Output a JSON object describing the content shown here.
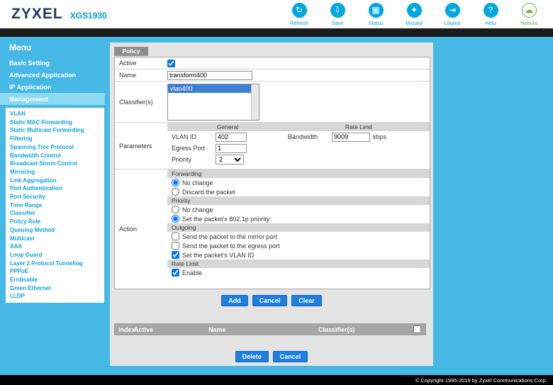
{
  "header": {
    "logo": "ZYXEL",
    "model": "XGS1930",
    "toolbar": [
      {
        "label": "Refresh",
        "glyph": "↻"
      },
      {
        "label": "Save",
        "glyph": "⇩"
      },
      {
        "label": "Status",
        "glyph": "▦"
      },
      {
        "label": "Wizard",
        "glyph": "✦"
      },
      {
        "label": "Logout",
        "glyph": "⇥"
      },
      {
        "label": "Help",
        "glyph": "?"
      },
      {
        "label": "Nebula",
        "glyph": "☁"
      }
    ]
  },
  "sidebar": {
    "title": "Menu",
    "sections": [
      {
        "label": "Basic Setting",
        "active": false
      },
      {
        "label": "Advanced Application",
        "active": false
      },
      {
        "label": "IP Application",
        "active": false
      },
      {
        "label": "Management",
        "active": true
      }
    ],
    "links": [
      "VLAN",
      "Static MAC Forwarding",
      "Static Multicast Forwarding",
      "Filtering",
      "Spanning Tree Protocol",
      "Bandwidth Control",
      "Broadcast Storm Control",
      "Mirroring",
      "Link Aggregation",
      "Port Authentication",
      "Port Security",
      "Time Range",
      "Classifier",
      "Policy Rule",
      "Queuing Method",
      "Multicast",
      "AAA",
      "Loop Guard",
      "Layer 2 Protocol Tunneling",
      "PPPoE",
      "Errdisable",
      "Green Ethernet",
      "LLDP"
    ]
  },
  "content": {
    "tab_label": "Policy",
    "form": {
      "active_label": "Active",
      "active_checked": true,
      "name_label": "Name",
      "name_value": "transform400",
      "classifiers_label": "Classifier(s)",
      "classifier_selected": "vlan400",
      "parameters_label": "Parameters",
      "general_header": "General",
      "rate_limit_header": "Rate Limit",
      "vlan_id_label": "VLAN ID",
      "vlan_id_value": "402",
      "bandwidth_label": "Bandwidth",
      "bandwidth_value": "9009",
      "bandwidth_unit": "kbps",
      "egress_port_label": "Egress Port",
      "egress_port_value": "1",
      "priority_label": "Priority",
      "priority_value": "2",
      "action_label": "Action",
      "action_sections": [
        {
          "title": "Forwarding",
          "options": [
            {
              "type": "radio",
              "label": "No change",
              "checked": true
            },
            {
              "type": "radio",
              "label": "Discard the packet",
              "checked": false
            }
          ]
        },
        {
          "title": "Priority",
          "options": [
            {
              "type": "radio",
              "label": "No change",
              "checked": false
            },
            {
              "type": "radio",
              "label": "Set the packet's 802.1p priority",
              "checked": true
            }
          ]
        },
        {
          "title": "Outgoing",
          "options": [
            {
              "type": "checkbox",
              "label": "Send the packet to the mirror port",
              "checked": false
            },
            {
              "type": "checkbox",
              "label": "Send the packet to the egress port",
              "checked": false
            },
            {
              "type": "checkbox",
              "label": "Set the packet's VLAN ID",
              "checked": true
            }
          ]
        },
        {
          "title": "Rate Limit",
          "options": [
            {
              "type": "checkbox",
              "label": "Enable",
              "checked": true
            }
          ]
        }
      ]
    },
    "form_buttons": {
      "add": "Add",
      "cancel": "Cancel",
      "clear": "Clear"
    },
    "table": {
      "columns": {
        "index": "Index",
        "active": "Active",
        "name": "Name",
        "classifiers": "Classifier(s)"
      },
      "select_all_checked": false
    },
    "table_buttons": {
      "delete": "Delete",
      "cancel": "Cancel"
    }
  },
  "footer": {
    "copyright": "© Copyright 1995-2019 by Zyxel Communications Corp."
  },
  "colors": {
    "accent": "#00a7e1",
    "nebula_green": "#5cb531",
    "background_cyan": "#45b8e6"
  }
}
